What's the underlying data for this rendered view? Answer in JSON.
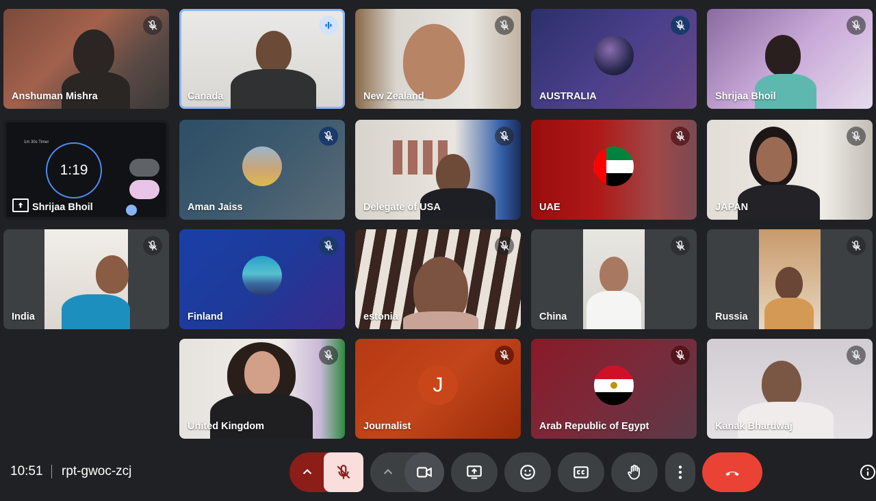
{
  "tiles": [
    {
      "name": "Anshuman Mishra"
    },
    {
      "name": "Canada"
    },
    {
      "name": "New Zealand"
    },
    {
      "name": "AUSTRALIA"
    },
    {
      "name": "Shrijaa Bhoil"
    },
    {
      "name": "Shrijaa Bhoil",
      "screen": {
        "timer_title": "1m 30s Timer",
        "time": "1:19"
      }
    },
    {
      "name": "Aman Jaiss"
    },
    {
      "name": "Delegate of USA"
    },
    {
      "name": "UAE"
    },
    {
      "name": "JAPAN"
    },
    {
      "name": "India"
    },
    {
      "name": "Finland"
    },
    {
      "name": "estonia"
    },
    {
      "name": "China"
    },
    {
      "name": "Russia"
    },
    {
      "name": "United Kingdom"
    },
    {
      "name": "Journalist",
      "initial": "J"
    },
    {
      "name": "Arab Republic of Egypt"
    },
    {
      "name": "Kanak Bhardwaj"
    }
  ],
  "meeting": {
    "time": "10:51",
    "code": "rpt-gwoc-zcj"
  },
  "colors": {
    "bar_bg": "#202124",
    "button": "#3c4043",
    "end_call": "#ea4335",
    "mic_off": "#f9dedc",
    "mic_off_dark": "#8c1d18",
    "speaking": "#8ab4f8"
  }
}
